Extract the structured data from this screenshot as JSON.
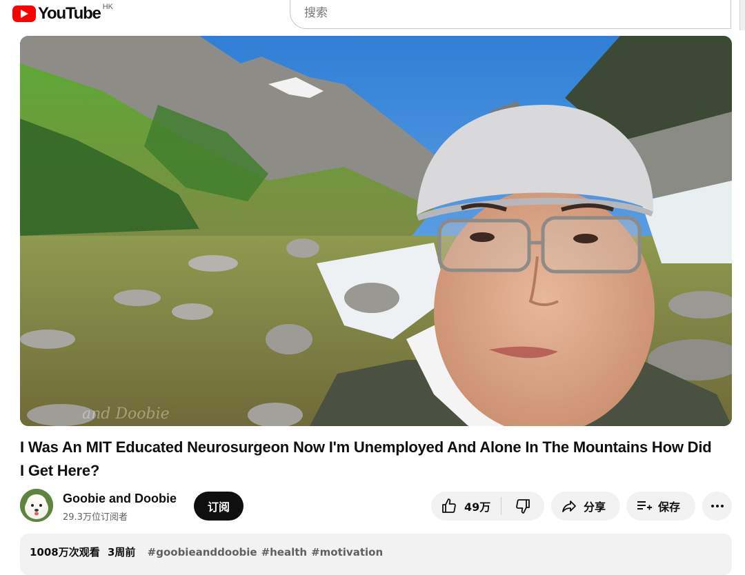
{
  "header": {
    "logo_text": "YouTube",
    "region": "HK",
    "search_placeholder": "搜索"
  },
  "video": {
    "watermark": "and Doobie",
    "title": "I Was An MIT Educated Neurosurgeon Now I'm Unemployed And Alone In The Mountains How Did I Get Here?"
  },
  "channel": {
    "name": "Goobie and Doobie",
    "subscribers": "29.3万位订阅者",
    "subscribe_label": "订阅"
  },
  "actions": {
    "likes": "49万",
    "share_label": "分享",
    "save_label": "保存",
    "more_icon": "more-horizontal-icon"
  },
  "description": {
    "views": "1008万次观看",
    "age": "3周前",
    "tags": [
      "#goobieanddoobie",
      "#health",
      "#motivation"
    ]
  },
  "colors": {
    "brand_red": "#ff0000",
    "pill_bg": "#f2f2f2",
    "subscribe_bg": "#0f0f0f"
  }
}
